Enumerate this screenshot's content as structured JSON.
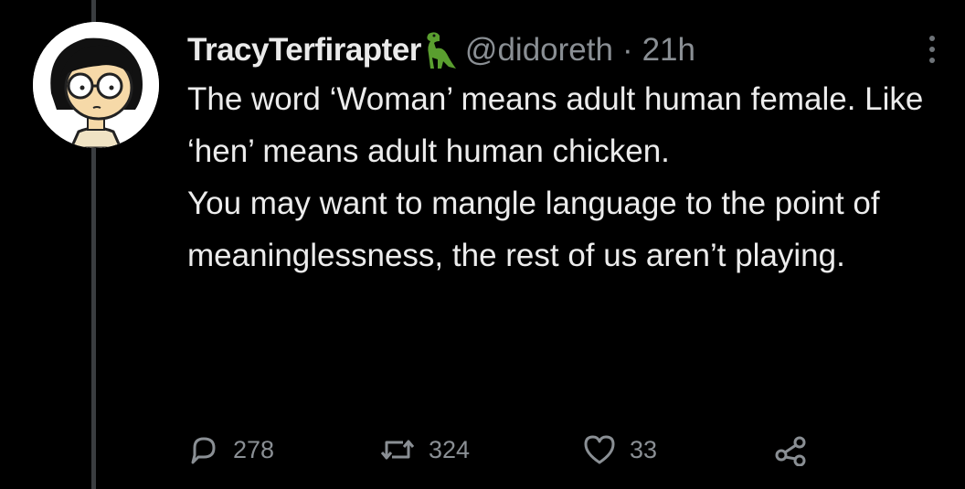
{
  "colors": {
    "background": "#000000",
    "text": "#e7e9ea",
    "secondary": "#8a8f94",
    "thread_line": "#3a3d40",
    "dino_green": "#5a9e2f"
  },
  "tweet": {
    "display_name": "TracyTerfirapter",
    "name_emoji": "dinosaur-icon",
    "handle": "@didoreth",
    "separator": "·",
    "time": "21h",
    "paragraphs": [
      "The word ‘Woman’ means adult human female.  Like ‘hen’ means adult human chicken.",
      "You may want to mangle language to the point of meaninglessness, the rest of us aren’t playing."
    ]
  },
  "actions": {
    "replies": "278",
    "retweets": "324",
    "likes": "33"
  },
  "icons": {
    "reply": "reply-icon",
    "retweet": "retweet-icon",
    "like": "heart-icon",
    "share": "share-icon",
    "more": "more-options-icon"
  }
}
